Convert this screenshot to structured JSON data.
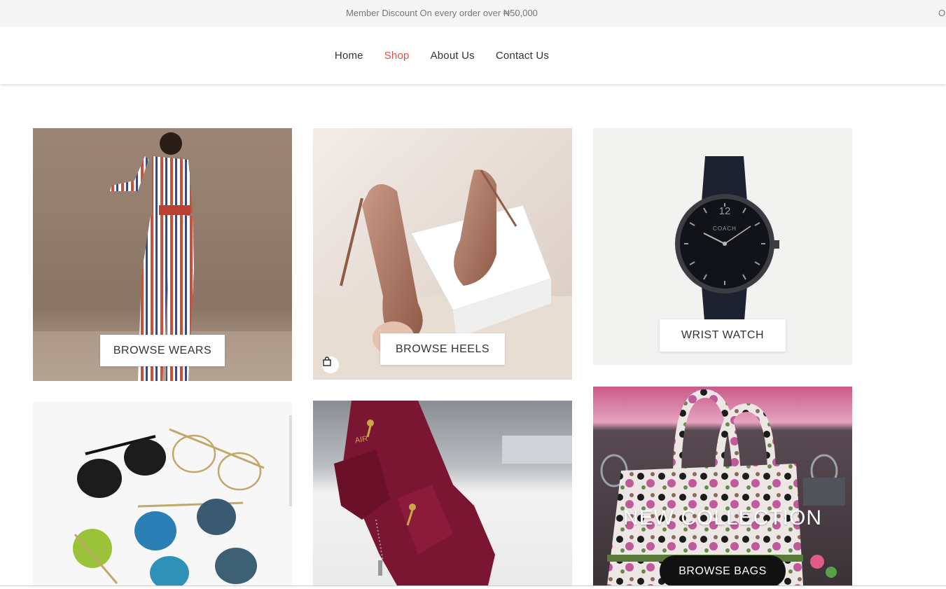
{
  "announcement": {
    "text": "Member Discount On every order over ₦50,000",
    "overflow_text": "O"
  },
  "nav": {
    "items": [
      {
        "label": "Home"
      },
      {
        "label": "Shop"
      },
      {
        "label": "About Us"
      },
      {
        "label": "Contact Us"
      }
    ],
    "active": "Shop"
  },
  "tiles": {
    "wears": {
      "button": "BROWSE WEARS"
    },
    "heels": {
      "button": "BROWSE HEELS"
    },
    "watch": {
      "button": "WRIST WATCH",
      "brand": "COACH",
      "dial_number": "12"
    },
    "bags": {
      "headline": "NEW COLLECTION",
      "button": "BROWSE BAGS"
    },
    "sneakers": {
      "brand_mark": "AIR"
    }
  },
  "colors": {
    "accent": "#d9534f",
    "topbar_bg": "#f5f5f5"
  }
}
